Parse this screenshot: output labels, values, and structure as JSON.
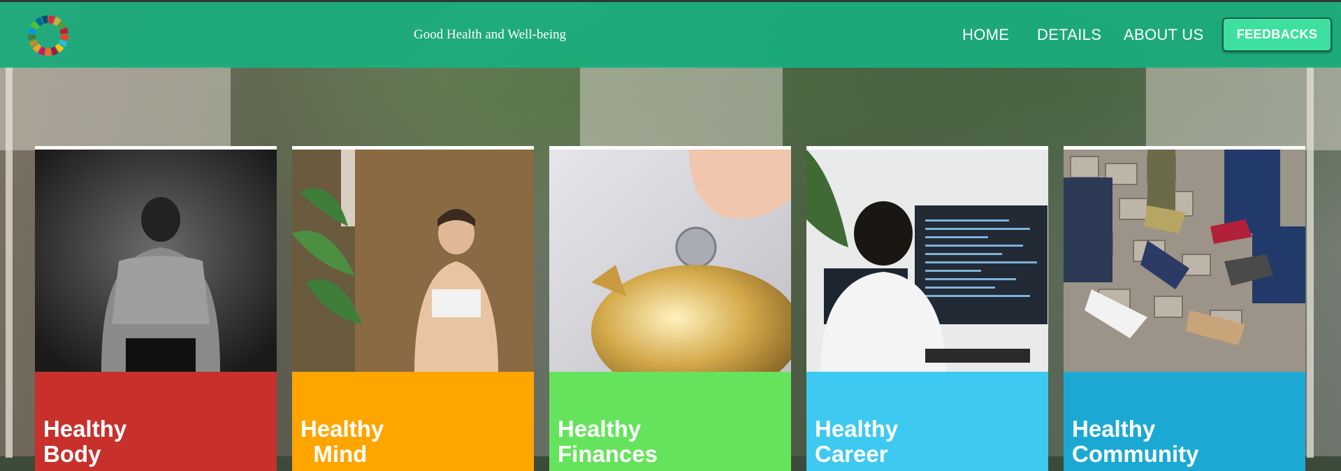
{
  "navbar": {
    "brand": "Good Health and Well-being",
    "links": [
      "HOME",
      "DETAILS",
      "ABOUT US"
    ],
    "button_label": "FEEDBACKS",
    "background_color": "#16b280",
    "button_color": "#3ee0a0"
  },
  "logo": {
    "icon": "sdg-color-wheel-icon",
    "colors": [
      "#e5243b",
      "#dda63a",
      "#4c9f38",
      "#c5192d",
      "#ff3a21",
      "#26bde2",
      "#fcc30b",
      "#a21942",
      "#fd6925",
      "#dd1367",
      "#fd9d24",
      "#bf8b2e",
      "#3f7e44",
      "#0a97d9",
      "#56c02b",
      "#00689d",
      "#19486a"
    ]
  },
  "cards": [
    {
      "title_line1": "Healthy",
      "title_line2": "Body",
      "panel_color": "#c8302c",
      "photo": "shirtless-man-back-photo"
    },
    {
      "title_line1": "Healthy",
      "title_line2": "  Mind",
      "panel_color": "#ffa500",
      "photo": "woman-meditating-photo"
    },
    {
      "title_line1": "Healthy",
      "title_line2": "Finances",
      "panel_color": "#66e35c",
      "photo": "piggy-bank-coin-photo"
    },
    {
      "title_line1": "Healthy",
      "title_line2": "Career",
      "panel_color": "#3ec9f0",
      "photo": "man-coding-at-computer-photo"
    },
    {
      "title_line1": "Healthy",
      "title_line2": "Community",
      "panel_color": "#1ba9d4",
      "photo": "group-feet-circle-photo"
    }
  ]
}
